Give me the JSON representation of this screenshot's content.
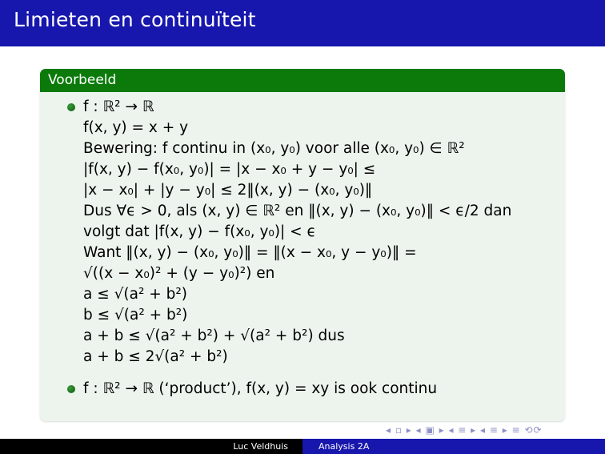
{
  "slide": {
    "title": "Limieten en continuïteit",
    "block_title": "Voorbeeld",
    "lines": [
      "f : ℝ² → ℝ",
      "f(x, y) = x + y",
      "Bewering: f continu in (x₀, y₀) voor alle (x₀, y₀) ∈ ℝ²",
      "|f(x, y) − f(x₀, y₀)| = |x − x₀ + y − y₀| ≤",
      "|x − x₀| + |y − y₀| ≤ 2‖(x, y) − (x₀, y₀)‖",
      "Dus ∀ϵ > 0, als (x, y) ∈ ℝ² en ‖(x, y) − (x₀, y₀)‖ < ϵ/2 dan",
      "volgt dat |f(x, y) − f(x₀, y₀)| < ϵ",
      "Want ‖(x, y) − (x₀, y₀)‖ = ‖(x − x₀, y − y₀)‖ =",
      "√((x − x₀)² + (y − y₀)²) en",
      "a ≤ √(a² + b²)",
      "b ≤ √(a² + b²)",
      "a + b ≤ √(a² + b²) + √(a² + b²) dus",
      "a + b ≤ 2√(a² + b²)"
    ],
    "last_bullet": "f : ℝ² → ℝ (‘product’), f(x, y) = xy is ook continu"
  },
  "footer": {
    "author": "Luc Veldhuis",
    "course": "Analysis 2A"
  },
  "nav": {
    "symbols": "◂ ▫ ▸ ◂ ▣ ▸ ◂ ≡ ▸ ◂ ≡ ▸  ≡  ⟲⟳"
  }
}
